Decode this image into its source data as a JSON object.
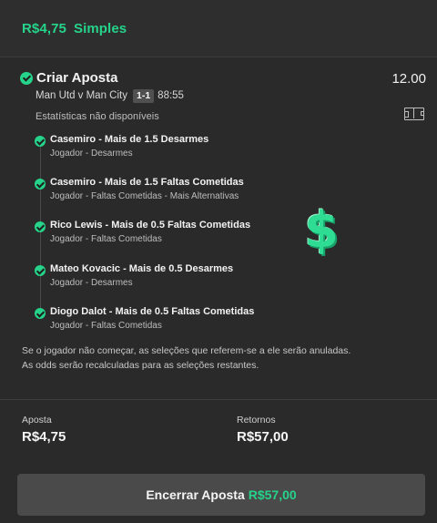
{
  "header": {
    "stake": "R$4,75",
    "type": "Simples"
  },
  "bet": {
    "title": "Criar Aposta",
    "odds": "12.00",
    "match": "Man Utd v Man City",
    "score": "1-1",
    "time": "88:55",
    "stats_text": "Estatísticas não disponíveis",
    "stats_icon": "pitch-icon"
  },
  "selections": [
    {
      "title": "Casemiro - Mais de 1.5 Desarmes",
      "subtitle": "Jogador - Desarmes"
    },
    {
      "title": "Casemiro - Mais de 1.5 Faltas Cometidas",
      "subtitle": "Jogador - Faltas Cometidas - Mais Alternativas"
    },
    {
      "title": "Rico Lewis - Mais de 0.5 Faltas Cometidas",
      "subtitle": "Jogador - Faltas Cometidas"
    },
    {
      "title": "Mateo Kovacic - Mais de 0.5 Desarmes",
      "subtitle": "Jogador - Desarmes"
    },
    {
      "title": "Diogo Dalot - Mais de 0.5 Faltas Cometidas",
      "subtitle": "Jogador - Faltas Cometidas"
    }
  ],
  "overlay_icon": "dollar-sign-icon",
  "overlay_glyph": "$",
  "notes": [
    "Se o jogador não começar, as seleções que referem-se a ele serão anuladas.",
    "As odds serão recalculadas para as seleções restantes."
  ],
  "summary": {
    "stake_label": "Aposta",
    "stake_value": "R$4,75",
    "returns_label": "Retornos",
    "returns_value": "R$57,00"
  },
  "cashout": {
    "label": "Encerrar Aposta",
    "amount": "R$57,00"
  },
  "colors": {
    "accent": "#25d38a",
    "background": "#2a2a2a",
    "button": "#4a4a4a"
  }
}
